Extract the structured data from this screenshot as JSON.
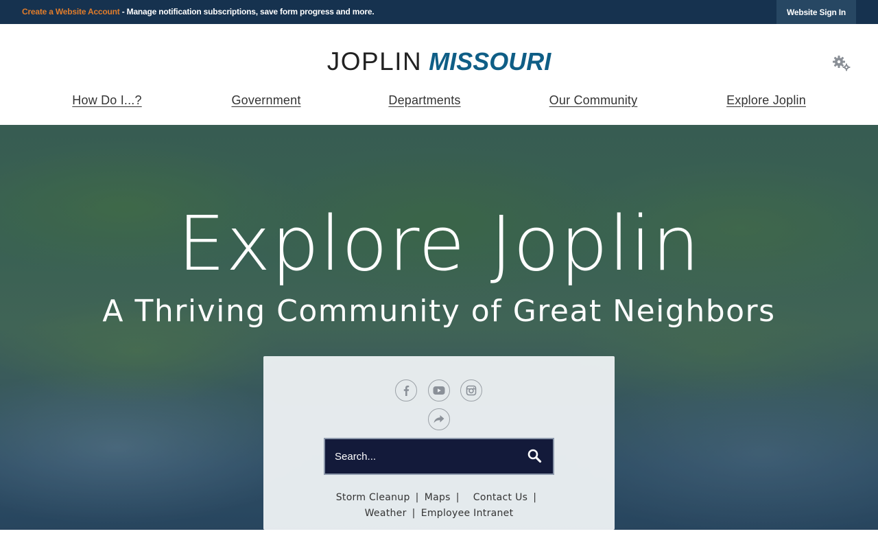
{
  "topbar": {
    "create_account": "Create a Website Account",
    "message": " - Manage notification subscriptions, save form progress and more.",
    "sign_in": "Website Sign In",
    "link_color": "#e07c2b",
    "background": "#16324f"
  },
  "header": {
    "logo_part1": "JOPLIN",
    "logo_part2": "MISSOURI",
    "settings_icon": "gear-icon"
  },
  "nav": {
    "items": [
      {
        "label": "How Do I...?"
      },
      {
        "label": "Government"
      },
      {
        "label": "Departments"
      },
      {
        "label": "Our Community"
      },
      {
        "label": "Explore Joplin"
      }
    ]
  },
  "hero": {
    "title": "Explore Joplin",
    "subtitle": "A Thriving Community of Great Neighbors"
  },
  "panel": {
    "social": [
      {
        "icon": "facebook-icon"
      },
      {
        "icon": "youtube-icon"
      },
      {
        "icon": "instagram-icon"
      },
      {
        "icon": "share-icon"
      }
    ],
    "search": {
      "placeholder": "Search...",
      "button_icon": "search-icon"
    },
    "quick_links": {
      "storm_cleanup": "Storm Cleanup",
      "maps": "Maps",
      "contact_us": "Contact Us",
      "weather": "Weather",
      "employee_intranet": "Employee Intranet",
      "separator": "|"
    }
  }
}
